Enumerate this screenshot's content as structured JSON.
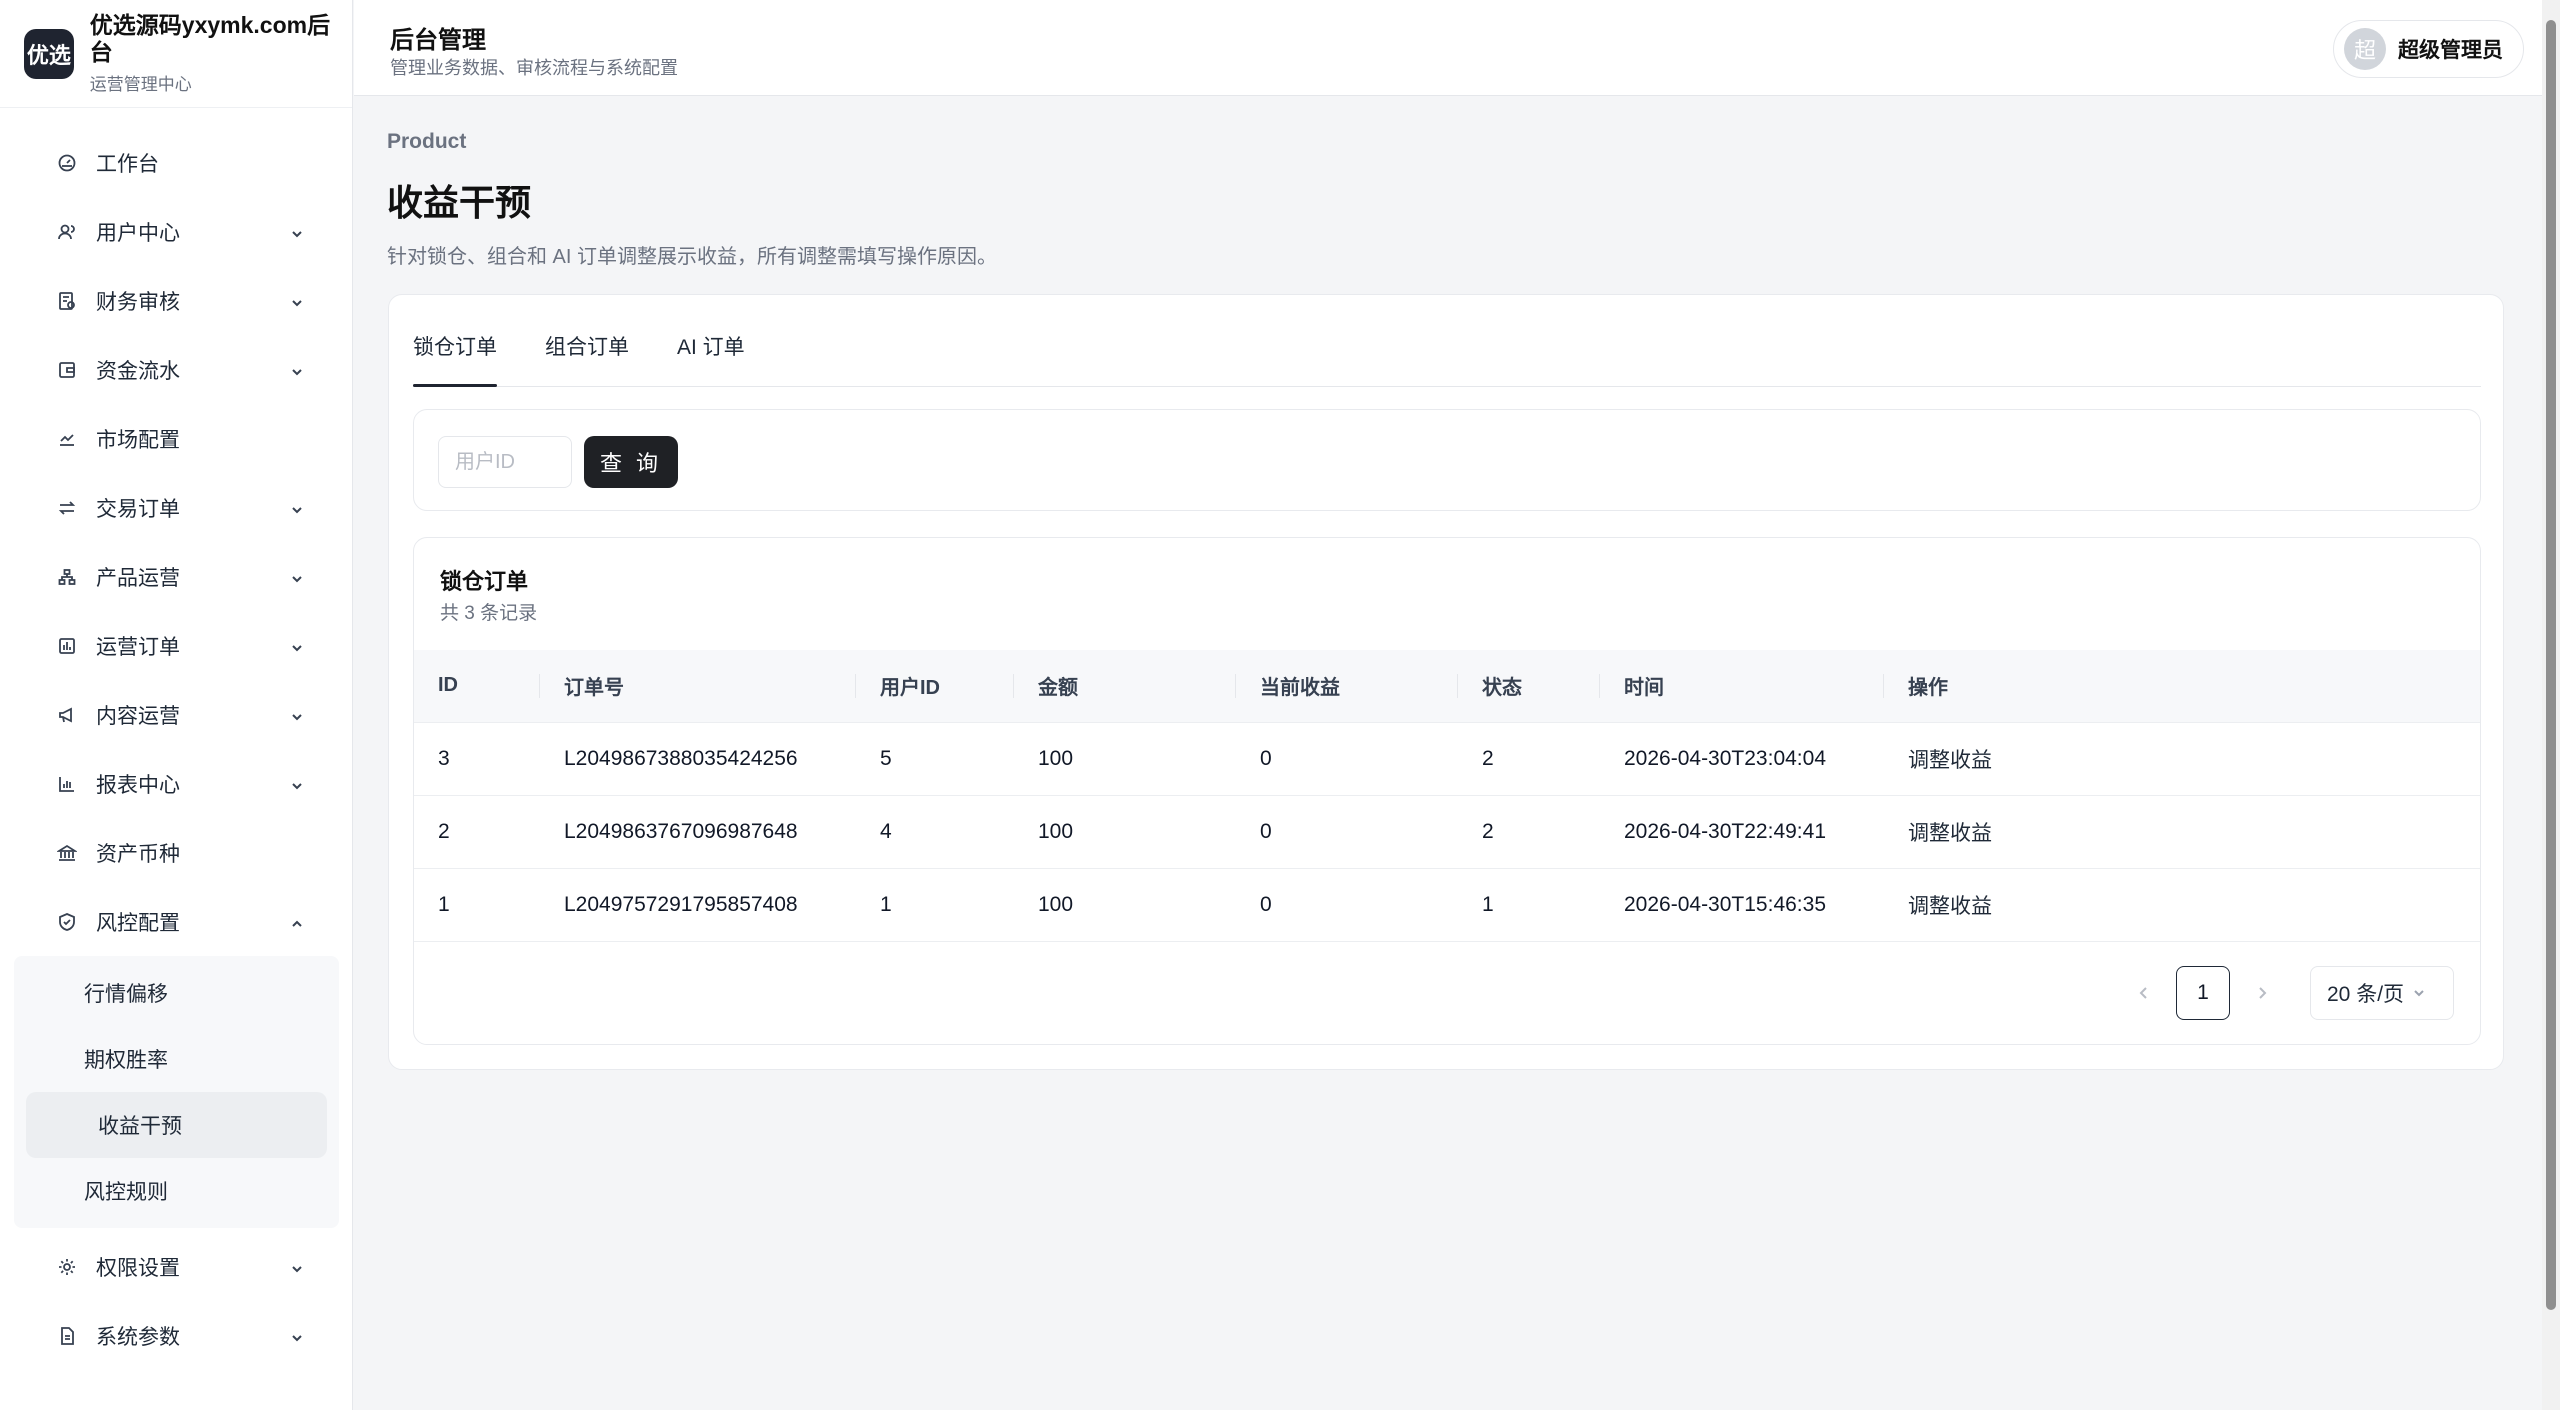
{
  "brand": {
    "logo": "优选",
    "title": "优选源码yxymk.com后台",
    "subtitle": "运营管理中心"
  },
  "header": {
    "title": "后台管理",
    "subtitle": "管理业务数据、审核流程与系统配置",
    "user_avatar": "超",
    "user_name": "超级管理员"
  },
  "sidebar": {
    "items": [
      {
        "label": "工作台",
        "icon": "dashboard-icon",
        "expandable": false
      },
      {
        "label": "用户中心",
        "icon": "users-icon",
        "expandable": true
      },
      {
        "label": "财务审核",
        "icon": "finance-icon",
        "expandable": true
      },
      {
        "label": "资金流水",
        "icon": "wallet-icon",
        "expandable": true
      },
      {
        "label": "市场配置",
        "icon": "chart-line-icon",
        "expandable": false
      },
      {
        "label": "交易订单",
        "icon": "swap-icon",
        "expandable": true
      },
      {
        "label": "产品运营",
        "icon": "sitemap-icon",
        "expandable": true
      },
      {
        "label": "运营订单",
        "icon": "calendar-chart-icon",
        "expandable": true
      },
      {
        "label": "内容运营",
        "icon": "megaphone-icon",
        "expandable": true
      },
      {
        "label": "报表中心",
        "icon": "bar-chart-icon",
        "expandable": true
      },
      {
        "label": "资产币种",
        "icon": "bank-icon",
        "expandable": false
      },
      {
        "label": "风控配置",
        "icon": "shield-icon",
        "expandable": true,
        "expanded": true
      }
    ],
    "risk_sub": [
      "行情偏移",
      "期权胜率",
      "收益干预",
      "风控规则"
    ],
    "active_sub": "收益干预",
    "bottom_items": [
      {
        "label": "权限设置",
        "icon": "gear-icon"
      },
      {
        "label": "系统参数",
        "icon": "document-icon"
      }
    ]
  },
  "page": {
    "breadcrumb": "Product",
    "title": "收益干预",
    "description": "针对锁仓、组合和 AI 订单调整展示收益，所有调整需填写操作原因。"
  },
  "tabs": [
    "锁仓订单",
    "组合订单",
    "AI 订单"
  ],
  "active_tab": "锁仓订单",
  "filter": {
    "placeholder": "用户ID",
    "query_label": "查 询"
  },
  "table": {
    "title": "锁仓订单",
    "count_text": "共 3 条记录",
    "columns": [
      "ID",
      "订单号",
      "用户ID",
      "金额",
      "当前收益",
      "状态",
      "时间",
      "操作"
    ],
    "rows": [
      [
        "3",
        "L2049867388035424256",
        "5",
        "100",
        "0",
        "2",
        "2026-04-30T23:04:04",
        "调整收益"
      ],
      [
        "2",
        "L2049863767096987648",
        "4",
        "100",
        "0",
        "2",
        "2026-04-30T22:49:41",
        "调整收益"
      ],
      [
        "1",
        "L2049757291795857408",
        "1",
        "100",
        "0",
        "1",
        "2026-04-30T15:46:35",
        "调整收益"
      ]
    ]
  },
  "pagination": {
    "current_page": "1",
    "page_size": "20 条/页"
  }
}
